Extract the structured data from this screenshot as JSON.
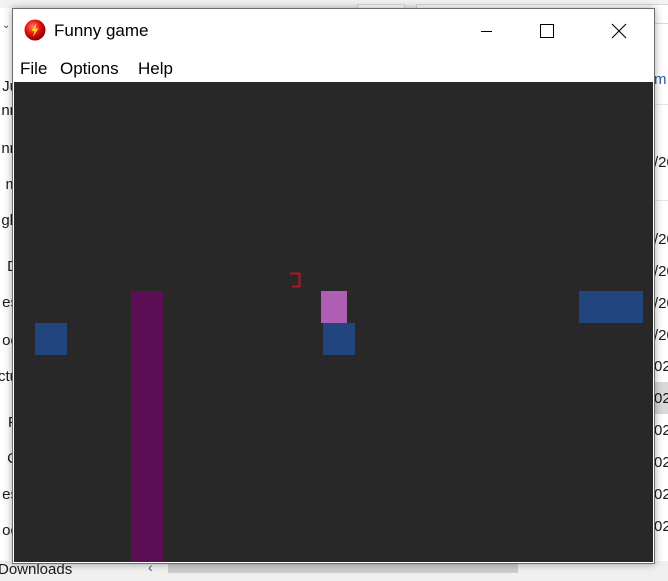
{
  "window": {
    "title": "Funny game",
    "icon": "red-ball-app-icon",
    "controls": {
      "minimize_icon": "minimize-icon",
      "maximize_icon": "maximize-icon",
      "close_icon": "close-icon"
    }
  },
  "menu": {
    "items": [
      {
        "label": "File"
      },
      {
        "label": "Options"
      },
      {
        "label": "Help"
      }
    ]
  },
  "game": {
    "colors": {
      "background": "#282828",
      "blue_block": "#23457f",
      "purple_pillar": "#5c0e55",
      "pink_player": "#ae5fb4",
      "red_marker": "#b2161b"
    }
  },
  "background_window": {
    "left_labels": [
      "Ju",
      "nn",
      "nn",
      "m",
      "gh",
      "D",
      "es",
      "oc",
      "ctu",
      "P",
      "C",
      "es",
      "oc"
    ],
    "right_labels": [
      "m",
      "/20",
      "/20",
      "/20",
      "/20",
      "/20",
      "02",
      "02",
      "02",
      "02",
      "02",
      "02"
    ],
    "bottom_label": "Downloads"
  }
}
